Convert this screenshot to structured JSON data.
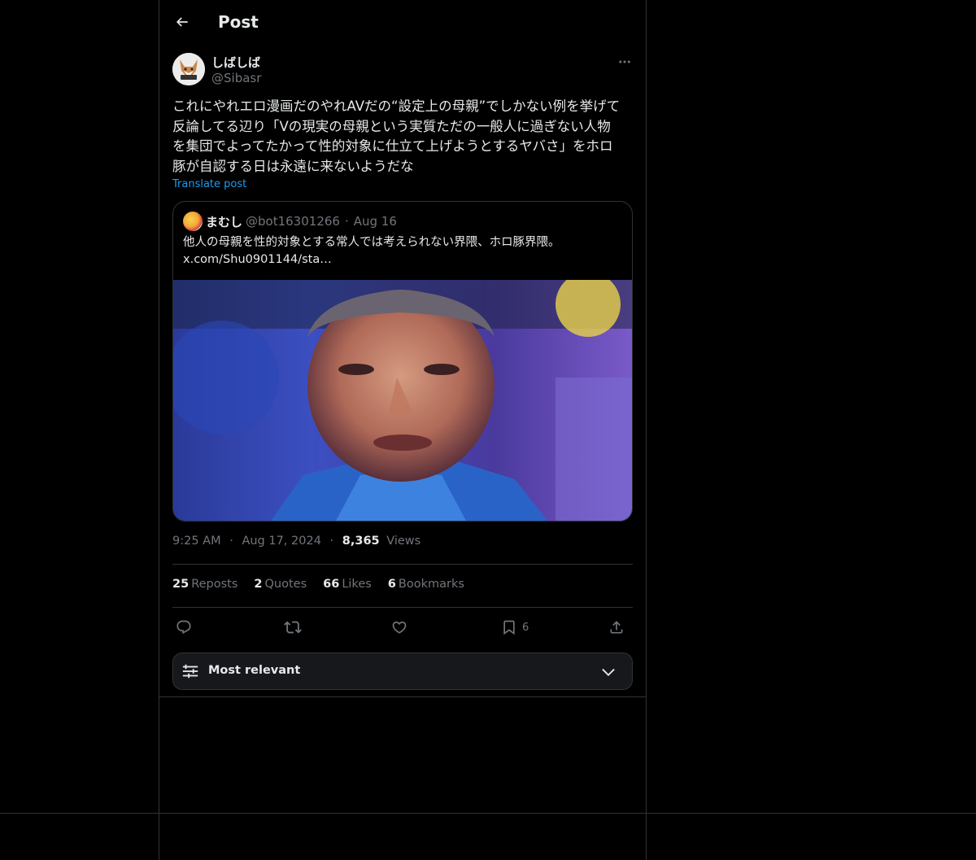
{
  "header": {
    "title": "Post"
  },
  "post": {
    "author_name": "しばしば",
    "author_handle": "@Sibasr",
    "text": "これにやれエロ漫画だのやれAVだの“設定上の母親”でしかない例を挙げて\n反論してる辺り「Vの現実の母親という実質ただの一般人に過ぎない人物\nを集団でよってたかって性的対象に仕立て上げようとするヤバさ」をホロ\n豚が自認する日は永遠に来ないようだな",
    "translate_label": "Translate post",
    "time": "9:25 AM",
    "date": "Aug 17, 2024",
    "views_count": "8,365",
    "views_label": "Views",
    "separator": "·"
  },
  "quote": {
    "author_name": "まむし",
    "author_handle": "@bot16301266",
    "separator": "·",
    "date": "Aug 16",
    "text": "他人の母親を性的対象とする常人では考えられない界隈、ホロ豚界隈。",
    "link": "x.com/Shu0901144/sta…"
  },
  "stats": {
    "reposts_count": "25",
    "reposts_label": "Reposts",
    "quotes_count": "2",
    "quotes_label": "Quotes",
    "likes_count": "66",
    "likes_label": "Likes",
    "bookmarks_count": "6",
    "bookmarks_label": "Bookmarks"
  },
  "actions": {
    "bookmark_count": "6"
  },
  "sort": {
    "label": "Most relevant"
  },
  "colors": {
    "background": "#000000",
    "text_primary": "#e7e9ea",
    "text_secondary": "#71767b",
    "link": "#1d9bf0",
    "border": "#2f3336"
  },
  "icons": [
    "back-arrow-icon",
    "more-icon",
    "reply-icon",
    "repost-icon",
    "like-icon",
    "bookmark-icon",
    "share-icon",
    "sort-sliders-icon",
    "chevron-down-icon"
  ]
}
